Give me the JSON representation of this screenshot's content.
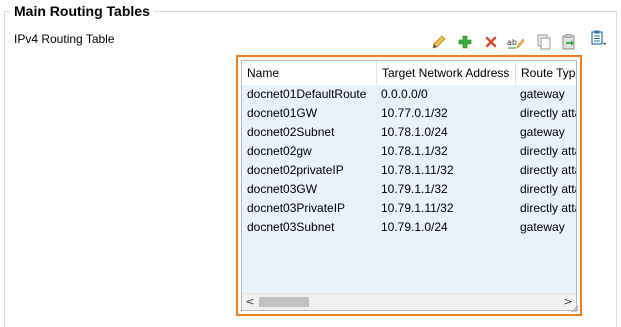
{
  "section": {
    "title": "Main Routing Tables"
  },
  "subsection": {
    "label": "IPv4 Routing Table"
  },
  "toolbar": {
    "icons": [
      "edit-icon",
      "add-icon",
      "delete-icon",
      "rename-icon",
      "copy-icon",
      "paste-icon",
      "menu-icon"
    ],
    "accent_green": "#3cab3c",
    "accent_red": "#d84a3a"
  },
  "table": {
    "highlight_color": "#ef7d1f",
    "columns": [
      "Name",
      "Target Network Address",
      "Route Type"
    ],
    "rows": [
      [
        "docnet01DefaultRoute",
        "0.0.0.0/0",
        "gateway"
      ],
      [
        "docnet01GW",
        "10.77.0.1/32",
        "directly attached"
      ],
      [
        "docnet02Subnet",
        "10.78.1.0/24",
        "gateway"
      ],
      [
        "docnet02gw",
        "10.78.1.1/32",
        "directly attached"
      ],
      [
        "docnet02privateIP",
        "10.78.1.11/32",
        "directly attached"
      ],
      [
        "docnet03GW",
        "10.79.1.1/32",
        "directly attached"
      ],
      [
        "docnet03PrivateIP",
        "10.79.1.11/32",
        "directly attached"
      ],
      [
        "docnet03Subnet",
        "10.79.1.0/24",
        "gateway"
      ]
    ],
    "scroll_left": "<",
    "scroll_right": ">"
  }
}
